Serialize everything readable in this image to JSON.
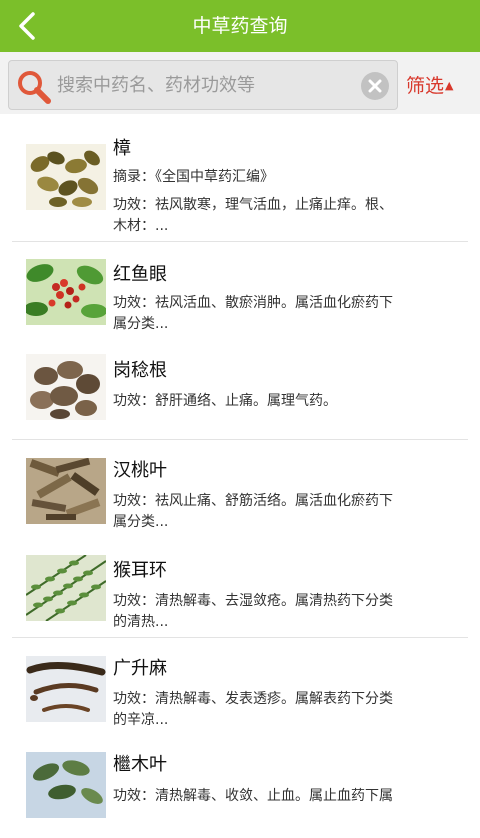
{
  "header": {
    "title": "中草药查询"
  },
  "search": {
    "placeholder": "搜索中药名、药材功效等"
  },
  "filter": {
    "label": "筛选",
    "arrow": "▲"
  },
  "items": [
    {
      "name": "樟",
      "line1": "摘录：《全国中草药汇编》",
      "line2": "功效：祛风散寒，理气活血，止痛止痒。根、",
      "line3": "木材：..."
    },
    {
      "name": "红鱼眼",
      "line1": "功效：祛风活血、散瘀消肿。属活血化瘀药下",
      "line2": "属分类...",
      "line3": ""
    },
    {
      "name": "岗稔根",
      "line1": "功效：舒肝通络、止痛。属理气药。",
      "line2": "",
      "line3": ""
    },
    {
      "name": "汉桃叶",
      "line1": "功效：祛风止痛、舒筋活络。属活血化瘀药下",
      "line2": "属分类...",
      "line3": ""
    },
    {
      "name": "猴耳环",
      "line1": "功效：清热解毒、去湿敛疮。属清热药下分类",
      "line2": "的清热...",
      "line3": ""
    },
    {
      "name": "广升麻",
      "line1": "功效：清热解毒、发表透疹。属解表药下分类",
      "line2": "的辛凉...",
      "line3": ""
    },
    {
      "name": "檵木叶",
      "line1": "功效：清热解毒、收敛、止血。属止血药下属",
      "line2": "",
      "line3": ""
    }
  ],
  "colors": {
    "header": "#7bbf2a",
    "filter": "#d8382c",
    "search_icon": "#e0583a"
  }
}
